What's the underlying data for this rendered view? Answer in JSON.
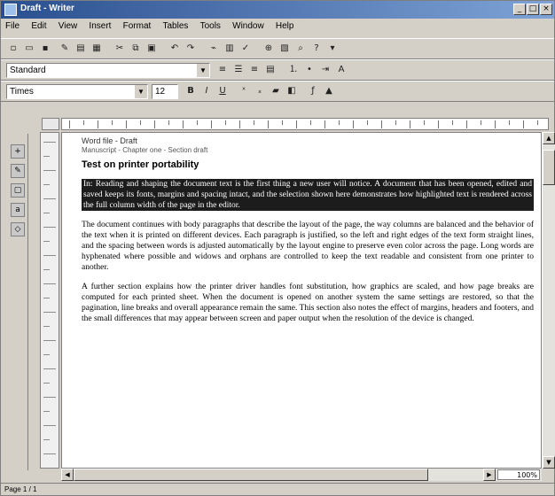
{
  "window": {
    "title": "Draft - Writer",
    "minimize": "_",
    "maximize": "□",
    "close": "×"
  },
  "menu": [
    "File",
    "Edit",
    "View",
    "Insert",
    "Format",
    "Tables",
    "Tools",
    "Window",
    "Help"
  ],
  "style_combo": {
    "value": "Standard"
  },
  "font_combo": {
    "value": "Times",
    "size": "12"
  },
  "document": {
    "header_line1": "Word file - Draft",
    "header_line2": "Manuscript - Chapter one - Section draft",
    "title": "Test on printer portability",
    "para_selected": "In: Reading and shaping the document text is the first thing a new user will notice. A document that has been opened, edited and saved keeps its fonts, margins and spacing intact, and the selection shown here demonstrates how highlighted text is rendered across the full column width of the page in the editor.",
    "para_body_1": "The document continues with body paragraphs that describe the layout of the page, the way columns are balanced and the behavior of the text when it is printed on different devices. Each paragraph is justified, so the left and right edges of the text form straight lines, and the spacing between words is adjusted automatically by the layout engine to preserve even color across the page. Long words are hyphenated where possible and widows and orphans are controlled to keep the text readable and consistent from one printer to another.",
    "para_body_2": "A further section explains how the printer driver handles font substitution, how graphics are scaled, and how page breaks are computed for each printed sheet. When the document is opened on another system the same settings are restored, so that the pagination, line breaks and overall appearance remain the same. This section also notes the effect of margins, headers and footers, and the small differences that may appear between screen and paper output when the resolution of the device is changed."
  },
  "zoom": "100%",
  "status": "Page 1 / 1"
}
